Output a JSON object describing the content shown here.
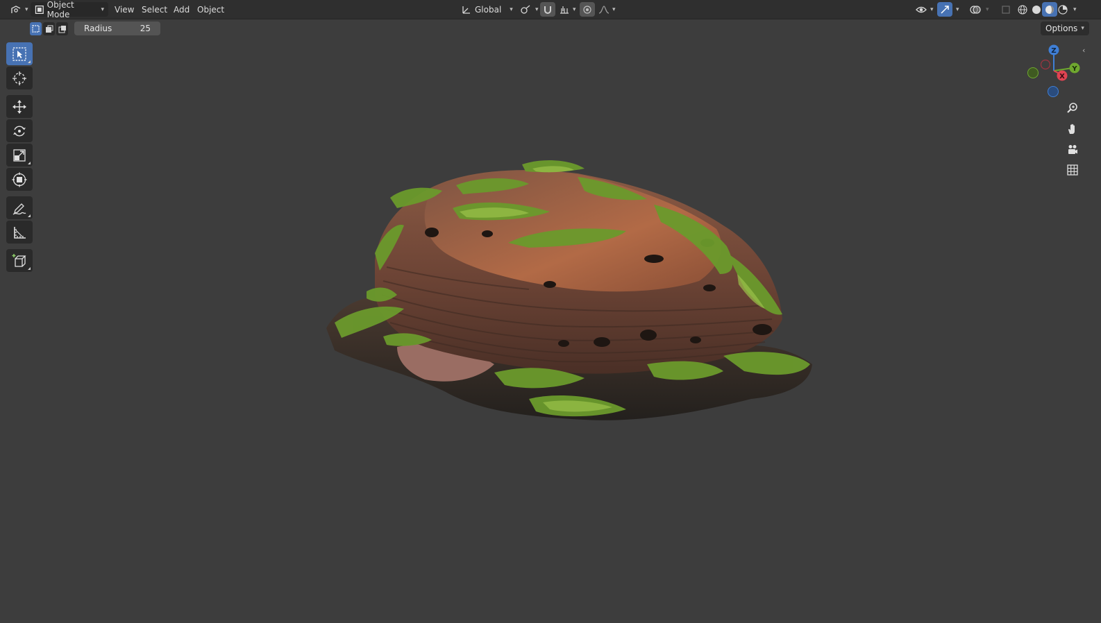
{
  "header": {
    "mode_label": "Object Mode",
    "menus": [
      "View",
      "Select",
      "Add",
      "Object"
    ],
    "orientation_label": "Global"
  },
  "tool_settings": {
    "radius_label": "Radius",
    "radius_value": "25",
    "options_label": "Options"
  },
  "toolbar": {
    "tools": [
      "select-box",
      "cursor",
      "move",
      "rotate",
      "scale",
      "transform",
      "annotate",
      "measure",
      "add-cube"
    ],
    "active_tool": "select-box"
  },
  "gizmo": {
    "axes": [
      "Z",
      "Y",
      "X"
    ],
    "colors": {
      "x": "#e04352",
      "y": "#6fa82f",
      "z": "#3f7fd6"
    }
  },
  "navigation": {
    "icons": [
      "zoom-icon",
      "hand-pan-icon",
      "camera-view-icon",
      "ortho-grid-icon"
    ]
  },
  "colors": {
    "accent": "#4772b3",
    "viewport_bg": "#3d3d3d",
    "header_bg": "#2f2f2f"
  }
}
